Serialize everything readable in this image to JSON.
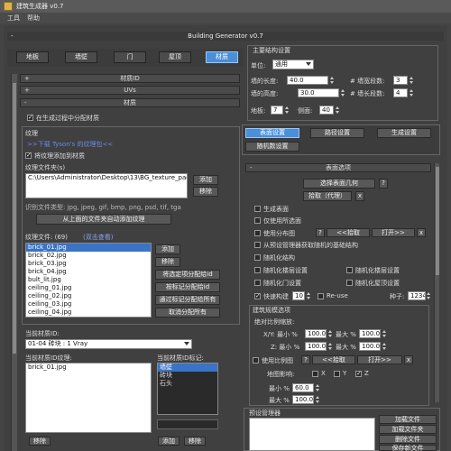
{
  "window": {
    "title": "建筑生成器 v0.7"
  },
  "menu": {
    "tools": "工具",
    "help": "帮助"
  },
  "panel": {
    "title": "Building Generator v0.7",
    "collapse": "-"
  },
  "tabs": [
    {
      "label": "地板"
    },
    {
      "label": "墙壁"
    },
    {
      "label": "门"
    },
    {
      "label": "屋顶"
    },
    {
      "label": "材质"
    }
  ],
  "material": {
    "id_group": "材质ID",
    "uvs_group": "UVs",
    "material_group": "材质",
    "plus": "+",
    "minus": "-",
    "assign_during_gen": "在生成过程中分配材质",
    "texture_label": "纹理",
    "download_link": ">>下载 Tyson's 的纹理包<<",
    "add_texture": "将纹理添加到材质",
    "texture_folder_label": "纹理文件夹(s)",
    "folder_path": "C:\\Users\\Administrator\\Desktop\\13\\BG_texture_pack",
    "add": "添加",
    "remove": "移除",
    "file_types": "识别文件类型: jpg, jpeg, gif, bmp, png, psd, tif, tga",
    "auto_add": "从上面的文件夹自动添加纹理",
    "texture_files_label": "纹理文件: (69)",
    "double_click_view": "(双击查看)",
    "files": [
      "brick_01.jpg",
      "brick_02.jpg",
      "brick_03.jpg",
      "brick_04.jpg",
      "bult_lit.jpg",
      "ceiling_01.jpg",
      "ceiling_02.jpg",
      "ceiling_03.jpg",
      "ceiling_04.jpg"
    ],
    "file_add": "添加",
    "file_remove": "移除",
    "assign_selected": "将选定项分配给id",
    "assign_by_tag": "按标记分配给id",
    "assign_all_by_tag": "通过标记分配给所有",
    "unassign_all": "取消分配所有",
    "current_id_label": "当前材质ID:",
    "current_id_value": "01-04    砖块                    : 1 Vray",
    "current_id_textures_label": "当前材质ID纹理:",
    "current_id_textures": [
      "brick_01.jpg"
    ],
    "current_id_tags_label": "当前材质ID标记:",
    "tags": [
      "墙壁",
      "砖块",
      "石头"
    ],
    "bottom_remove": "移除",
    "bottom_add": "添加",
    "bottom_remove2": "移除"
  },
  "main_settings": {
    "title": "主要结构设置",
    "units_label": "单位:",
    "units_value": "通用",
    "wall_length_label": "墙的长度:",
    "wall_length": "40.0",
    "wall_segments_label": "# 墙宽段数:",
    "wall_segments": "3",
    "wall_height_label": "墙的高度:",
    "wall_height": "30.0",
    "height_segments_label": "# 墙长段数:",
    "height_segments": "4",
    "floors_label": "地板:",
    "floors": "7",
    "sides_label": "侧面:",
    "sides": "40"
  },
  "mode_tabs": [
    {
      "label": "表面设置"
    },
    {
      "label": "路径设置"
    },
    {
      "label": "生成设置"
    },
    {
      "label": "随机数设置"
    }
  ],
  "surface": {
    "title": "表面选项",
    "select_geometry": "选择表面几何",
    "pick_proxy": "拾取（代理）",
    "q": "?",
    "x": "x",
    "gen_surface": "生成表面",
    "use_selected": "仅使用所选面",
    "use_ao": "使用分布图",
    "pick": "<<拾取",
    "open": "打开>>",
    "from_preset": "从预设管理器获取随机的基础结构",
    "random_structure": "随机化结构",
    "random_floor": "随机化楼层设置",
    "random_floor2": "随机化楼层设置",
    "random_door": "随机化门设置",
    "random_roof": "随机化屋顶设置",
    "fast_build": "快速构建",
    "fast_val": "10",
    "reuse": "Re-use",
    "seed_label": "种子:",
    "seed": "1234"
  },
  "scale": {
    "title": "建筑规模选项",
    "abs_scale": "绝对比例缩放:",
    "xy_min_label": "X/Y: 最小 %",
    "xy_min": "100.0",
    "xy_max_label": "最大 %",
    "xy_max": "100.0",
    "z_min_label": "Z: 最小 %",
    "z_min": "100.0",
    "z_max_label": "最大 %",
    "z_max": "100.0",
    "use_ratio": "使用比例图",
    "pick": "<<拾取",
    "open": "打开>>",
    "map_affect": "地图影响:",
    "ax_x": "X",
    "ax_y": "Y",
    "ax_z": "Z",
    "min_label": "最小 %",
    "min_val": "60.0",
    "max_label": "最大 %",
    "max_val": "100.0"
  },
  "preset": {
    "title": "预设管理器",
    "load_file": "加载文件",
    "load_file_set": "加载文件夹",
    "delete_file": "删除文件",
    "save_new": "保存新文件"
  }
}
